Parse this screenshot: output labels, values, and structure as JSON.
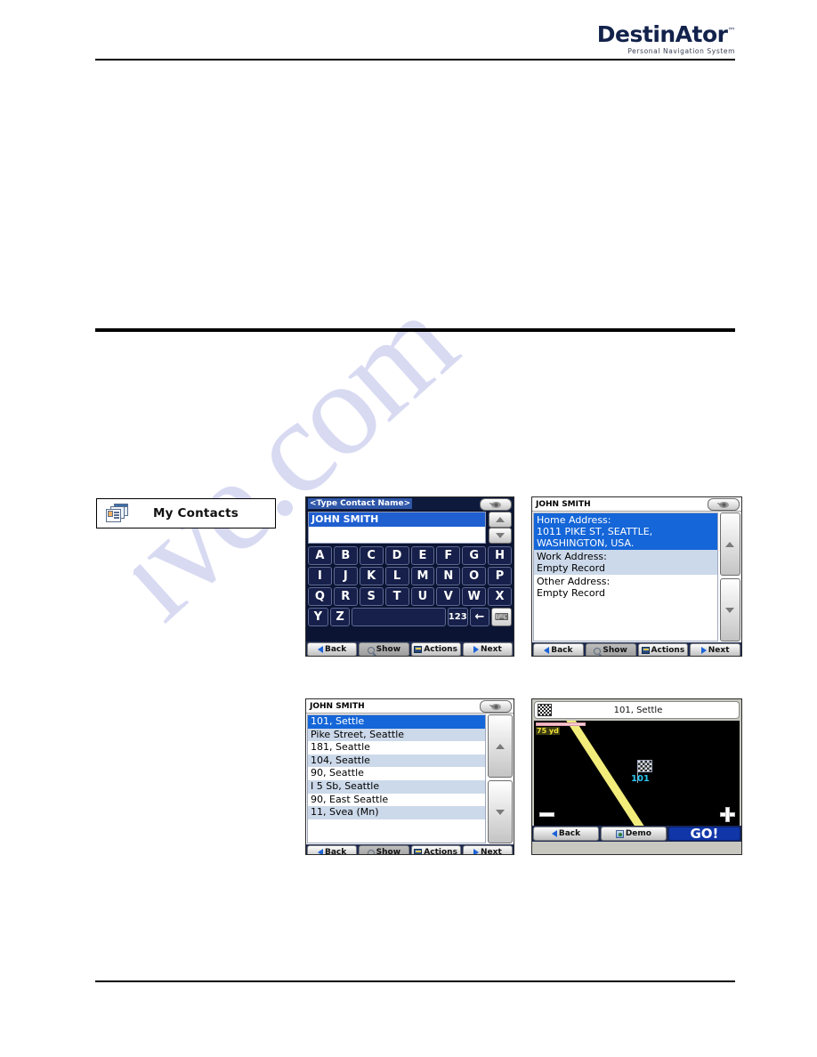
{
  "header": {
    "logo_main": "DestinAtor",
    "logo_tm": "™",
    "logo_sub": "Personal Navigation System"
  },
  "watermark": {
    "text": "ive.com"
  },
  "contacts_button": {
    "label": "My Contacts",
    "icon": "contacts-card-icon"
  },
  "screens": {
    "keyboard": {
      "title": "<Type Contact Name>",
      "eye_icon": "view-icon",
      "results": [
        {
          "text": "JOHN SMITH",
          "selected": true
        },
        {
          "text": "",
          "selected": false
        }
      ],
      "keys_row1": [
        "A",
        "B",
        "C",
        "D",
        "E",
        "F",
        "G",
        "H"
      ],
      "keys_row2": [
        "I",
        "J",
        "K",
        "L",
        "M",
        "N",
        "O",
        "P"
      ],
      "keys_row3": [
        "Q",
        "R",
        "S",
        "T",
        "U",
        "V",
        "W",
        "X"
      ],
      "keys_row4": [
        "Y",
        "Z"
      ],
      "key_space": "",
      "key_numbers": "123",
      "key_backspace": "←",
      "key_keyboard": "⌨",
      "toolbar": {
        "back": "Back",
        "show": "Show",
        "actions": "Actions",
        "next": "Next"
      }
    },
    "address": {
      "title": "JOHN SMITH",
      "eye_icon": "view-icon",
      "items": [
        {
          "label": "Home Address:",
          "value": "1011 PIKE ST, SEATTLE, WASHINGTON, USA.",
          "state": "selected"
        },
        {
          "label": "Work Address:",
          "value": "Empty Record",
          "state": "alt"
        },
        {
          "label": "Other Address:",
          "value": "Empty Record",
          "state": "normal"
        }
      ],
      "toolbar": {
        "back": "Back",
        "show": "Show",
        "actions": "Actions",
        "next": "Next"
      }
    },
    "results": {
      "title": "JOHN SMITH",
      "eye_icon": "view-icon",
      "rows": [
        {
          "text": "101, Settle",
          "state": "selected"
        },
        {
          "text": "Pike Street, Seattle",
          "state": "alt"
        },
        {
          "text": "181, Seattle",
          "state": "normal"
        },
        {
          "text": "104, Seattle",
          "state": "alt"
        },
        {
          "text": "90, Seattle",
          "state": "normal"
        },
        {
          "text": "I 5 Sb, Seattle",
          "state": "alt"
        },
        {
          "text": "90, East Seattle",
          "state": "normal"
        },
        {
          "text": "11, Svea (Mn)",
          "state": "alt"
        }
      ],
      "toolbar": {
        "back": "Back",
        "show": "Show",
        "actions": "Actions",
        "next": "Next"
      }
    },
    "map": {
      "title": "101, Settle",
      "flag_icon": "checkered-flag-icon",
      "scale": "75 yd",
      "marker_label": "101",
      "zoom_out": "−",
      "zoom_in": "+",
      "toolbar": {
        "back": "Back",
        "demo": "Demo",
        "go": "GO!"
      }
    }
  }
}
